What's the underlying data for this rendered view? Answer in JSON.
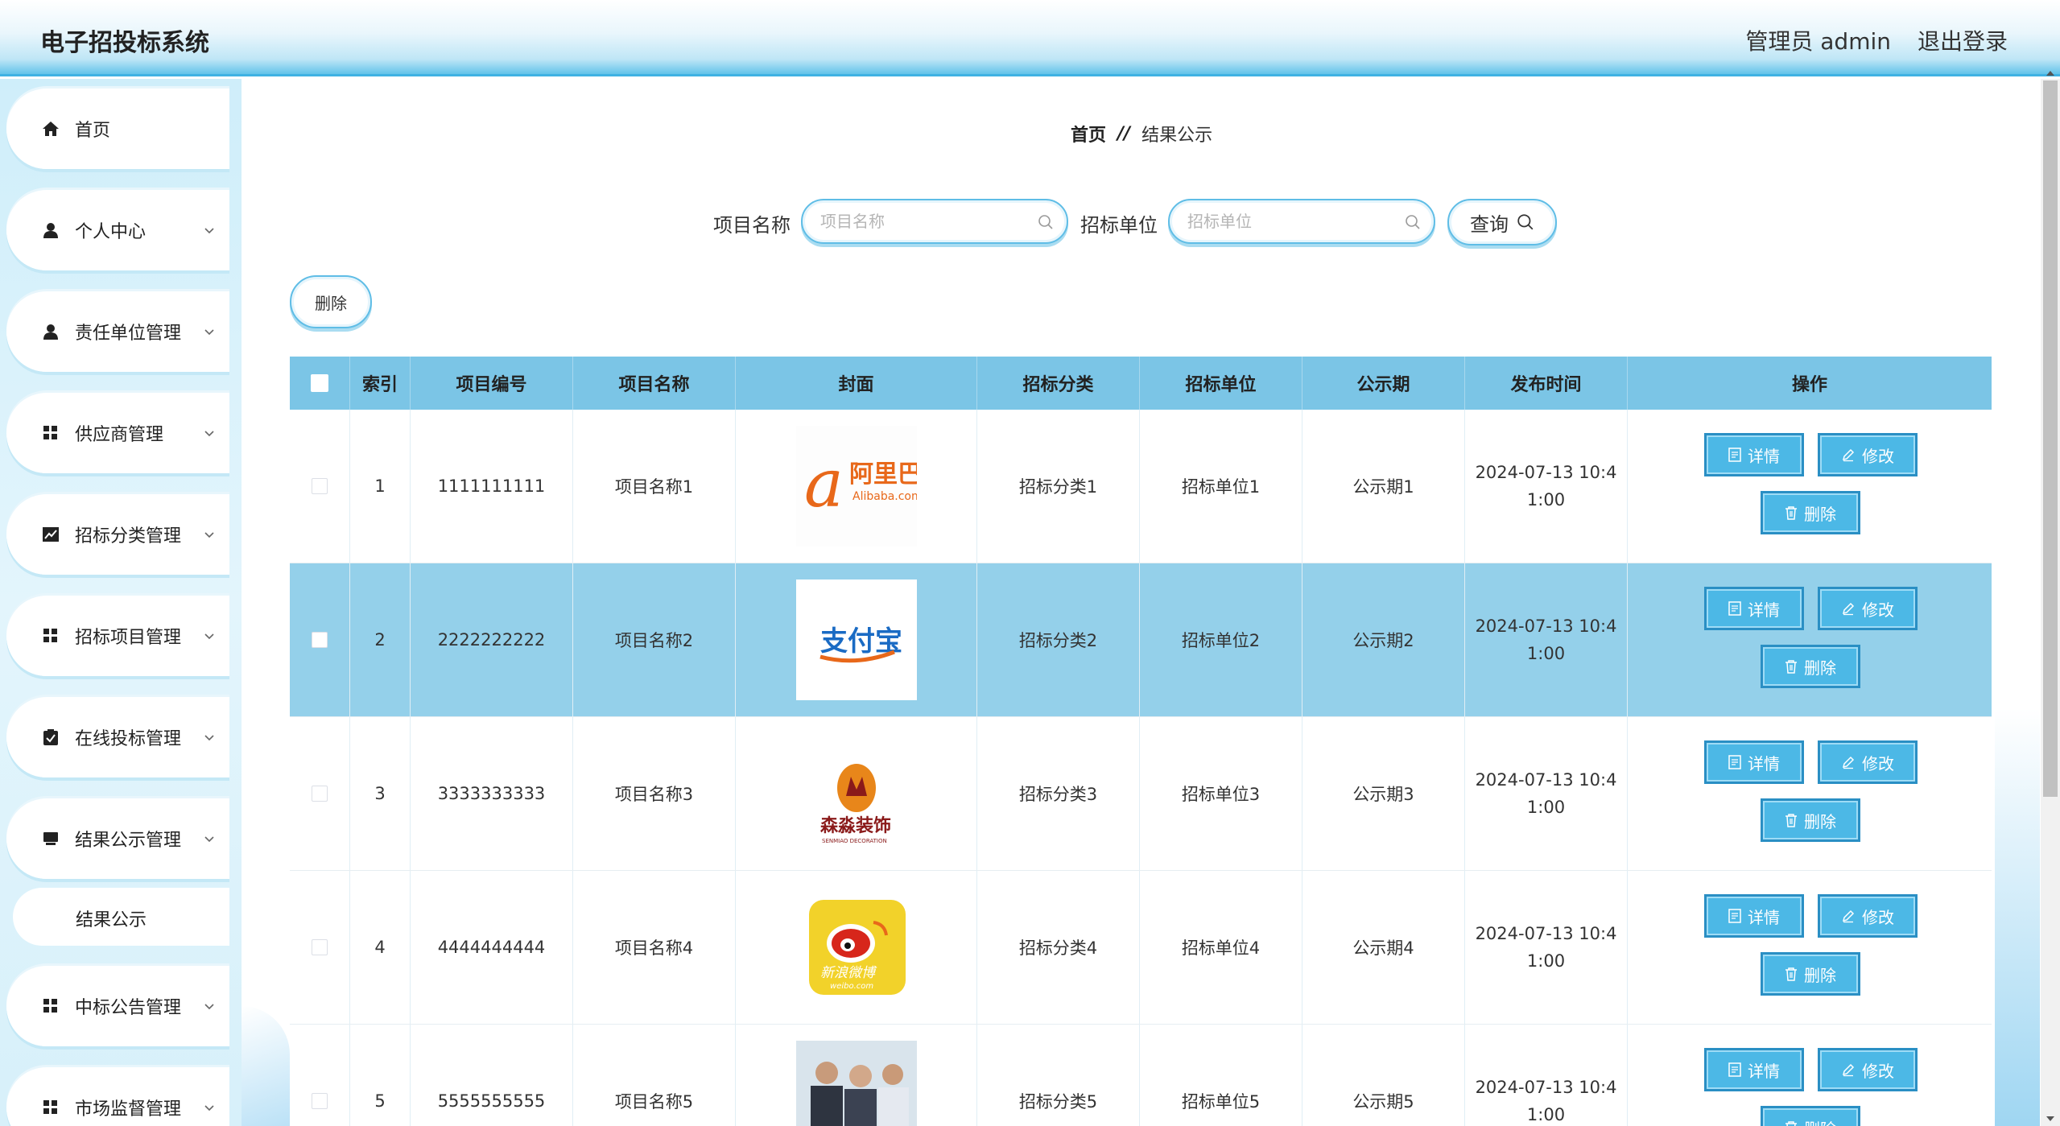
{
  "header": {
    "title": "电子招投标系统",
    "admin": "管理员 admin",
    "logout": "退出登录"
  },
  "sidebar": {
    "items": [
      {
        "label": "首页",
        "icon": "home-icon"
      },
      {
        "label": "个人中心",
        "icon": "user-icon"
      },
      {
        "label": "责任单位管理",
        "icon": "user-icon"
      },
      {
        "label": "供应商管理",
        "icon": "grid-icon"
      },
      {
        "label": "招标分类管理",
        "icon": "chart-icon"
      },
      {
        "label": "招标项目管理",
        "icon": "grid-icon"
      },
      {
        "label": "在线投标管理",
        "icon": "clipboard-icon"
      },
      {
        "label": "结果公示管理",
        "icon": "monitor-icon"
      },
      {
        "label": "中标公告管理",
        "icon": "grid-icon"
      },
      {
        "label": "市场监督管理",
        "icon": "grid-icon"
      }
    ],
    "submenu": {
      "label": "结果公示"
    }
  },
  "breadcrumb": {
    "home": "首页",
    "separator": "//",
    "current": "结果公示"
  },
  "search": {
    "name_label": "项目名称",
    "name_placeholder": "项目名称",
    "unit_label": "招标单位",
    "unit_placeholder": "招标单位",
    "query_label": "查询"
  },
  "toolbar": {
    "delete_label": "删除"
  },
  "table": {
    "headers": [
      "索引",
      "项目编号",
      "项目名称",
      "封面",
      "招标分类",
      "招标单位",
      "公示期",
      "发布时间",
      "操作"
    ],
    "actions": {
      "detail": "详情",
      "edit": "修改",
      "delete": "删除"
    },
    "rows": [
      {
        "index": "1",
        "code": "1111111111",
        "name": "项目名称1",
        "cover": "Alibaba logo",
        "category": "招标分类1",
        "unit": "招标单位1",
        "period": "公示期1",
        "time_line1": "2024-07-13 10:4",
        "time_line2": "1:00"
      },
      {
        "index": "2",
        "code": "2222222222",
        "name": "项目名称2",
        "cover": "Alipay logo",
        "category": "招标分类2",
        "unit": "招标单位2",
        "period": "公示期2",
        "time_line1": "2024-07-13 10:4",
        "time_line2": "1:00"
      },
      {
        "index": "3",
        "code": "3333333333",
        "name": "项目名称3",
        "cover": "Senmiao decoration logo",
        "category": "招标分类3",
        "unit": "招标单位3",
        "period": "公示期3",
        "time_line1": "2024-07-13 10:4",
        "time_line2": "1:00"
      },
      {
        "index": "4",
        "code": "4444444444",
        "name": "项目名称4",
        "cover": "Sina Weibo logo",
        "category": "招标分类4",
        "unit": "招标单位4",
        "period": "公示期4",
        "time_line1": "2024-07-13 10:4",
        "time_line2": "1:00"
      },
      {
        "index": "5",
        "code": "5555555555",
        "name": "项目名称5",
        "cover": "business people photo",
        "category": "招标分类5",
        "unit": "招标单位5",
        "period": "公示期5",
        "time_line1": "2024-07-13 10:4",
        "time_line2": "1:00"
      }
    ]
  },
  "cover_text": {
    "alibaba_cn": "阿里巴巴",
    "alibaba_en": "Alibaba.com",
    "alipay": "支付宝",
    "senmiao_cn": "森淼装饰",
    "senmiao_en": "SENMIAO DECORATION",
    "weibo_cn": "新浪微博",
    "weibo_en": "weibo.com"
  },
  "colors": {
    "accent": "#3fb2e3",
    "table_header": "#7bc5e6",
    "selected_row": "#94d0ea",
    "action_button": "#4cb8e6"
  }
}
